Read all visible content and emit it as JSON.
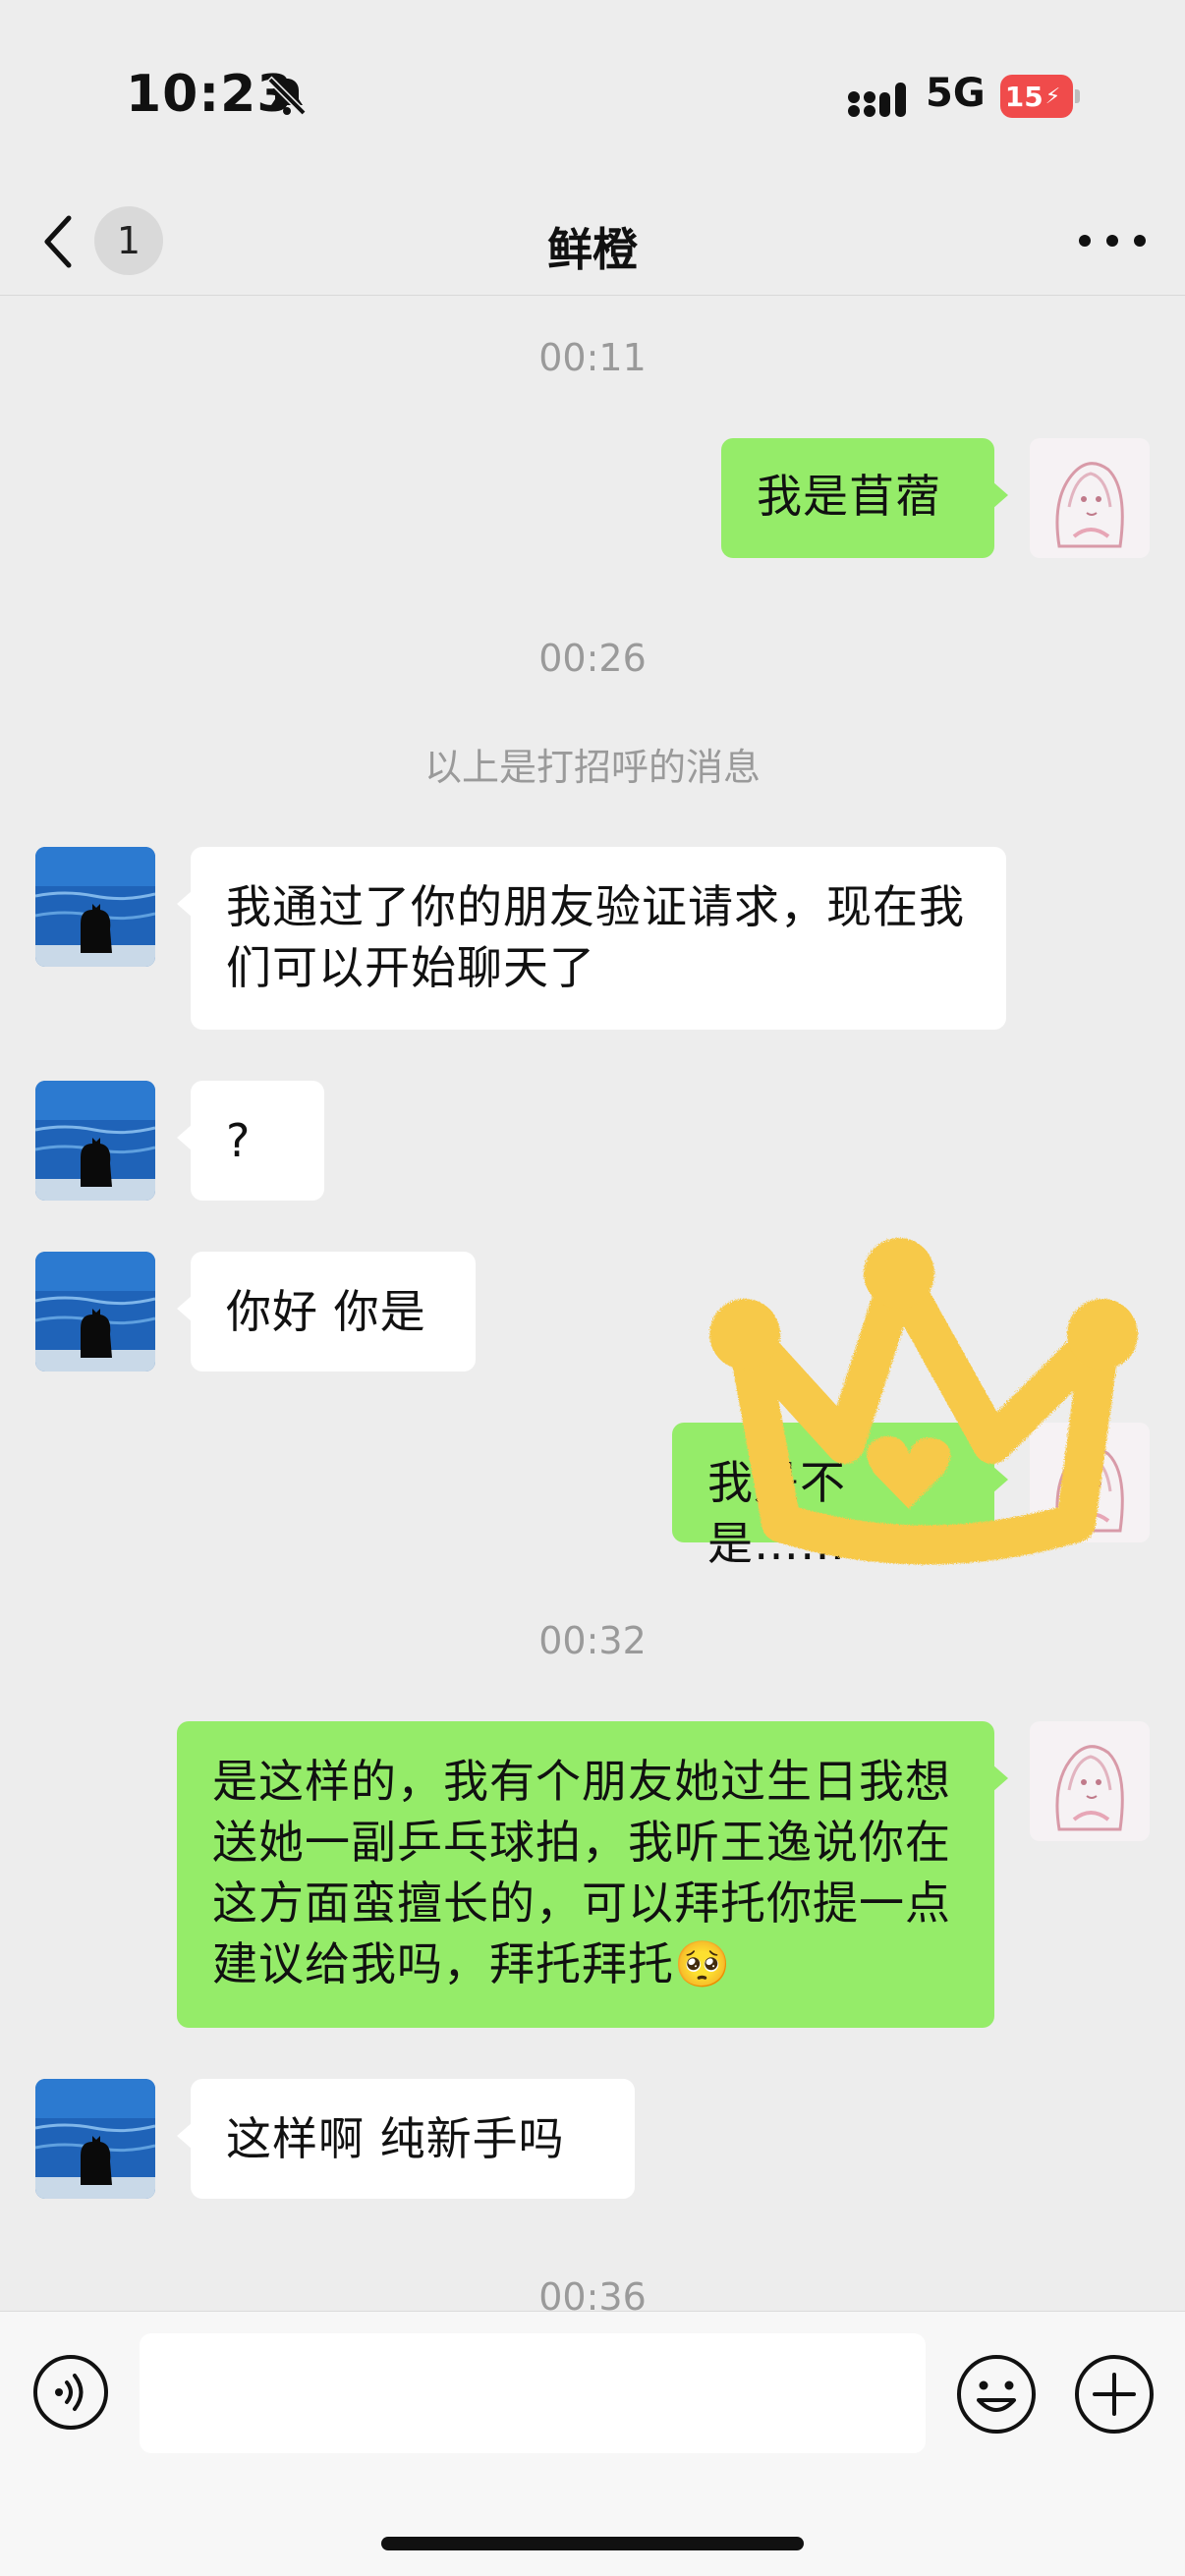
{
  "status_bar": {
    "time": "10:23",
    "network": "5G",
    "battery": "15"
  },
  "nav": {
    "title": "鲜橙",
    "unread_count": "1"
  },
  "messages": {
    "t1": "00:11",
    "m1": "我是苜蓿",
    "t2": "00:26",
    "system": "以上是打招呼的消息",
    "m2": "我通过了你的朋友验证请求，现在我们可以开始聊天了",
    "m3": "?",
    "m4": "你好 你是",
    "m5": "我是不是……",
    "t3": "00:32",
    "m6": "是这样的，我有个朋友她过生日我想送她一副乒乓球拍，我听王逸说你在这方面蛮擅长的，可以拜托你提一点建议给我吗，拜托拜托🥺",
    "m7": "这样啊 纯新手吗",
    "t4": "00:36"
  },
  "input": {
    "placeholder": ""
  },
  "colors": {
    "background": "#ededed",
    "bubble_out": "#95ec69",
    "bubble_in": "#ffffff",
    "battery_low": "#f04b4b"
  },
  "icons": {
    "back": "chevron-left-icon",
    "more": "more-dots-icon",
    "voice": "voice-icon",
    "emoji": "emoji-icon",
    "plus": "plus-icon",
    "mute": "bell-slash-icon",
    "signal": "signal-icon"
  }
}
